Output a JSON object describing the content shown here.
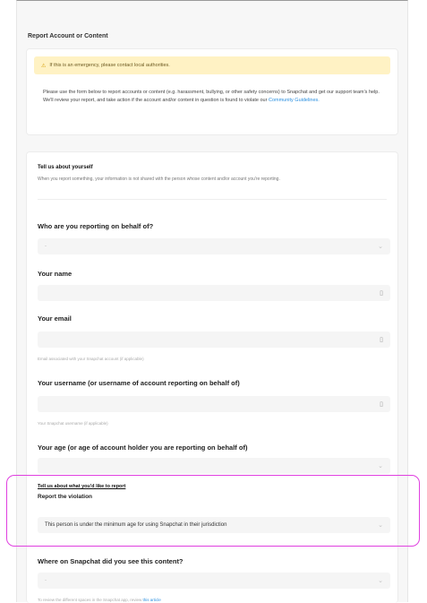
{
  "page": {
    "title": "Report Account or Content"
  },
  "alert": {
    "text": "If this is an emergency, please contact local authorities."
  },
  "intro": {
    "text": "Please use the form below to report accounts or content (e.g. harassment, bullying, or other safety concerns) to Snapchat and get our support team's help. We'll review your report, and take action if the account and/or content in question is found to violate our ",
    "link": "Community Guidelines."
  },
  "about_you": {
    "heading": "Tell us about yourself",
    "description": "When you report something, your information is not shared with the person whose content and/or account you're reporting."
  },
  "questions": {
    "behalf": {
      "label": "Who are you reporting on behalf of?",
      "value": "-"
    },
    "name": {
      "label": "Your name"
    },
    "email": {
      "label": "Your email",
      "helper": "Email associated with your Snapchat account (if applicable)"
    },
    "username": {
      "label": "Your username (or username of account reporting on behalf of)",
      "helper": "Your Snapchat username (if applicable)"
    },
    "age": {
      "label": "Your age (or age of account holder you are reporting on behalf of)"
    }
  },
  "report": {
    "heading": "Tell us about what you'd like to report",
    "violation_label": "Report the violation",
    "violation_value": "This person is under the minimum age for using Snapchat in their jurisdiction"
  },
  "where": {
    "label": "Where on Snapchat did you see this content?",
    "value": "-",
    "helper": "To review the different spaces in the Snapchat app, review ",
    "helper_link": "this article"
  },
  "colors": {
    "highlight": "#e040e0",
    "alert_bg": "#fff2c4",
    "link": "#2a8fe0"
  }
}
